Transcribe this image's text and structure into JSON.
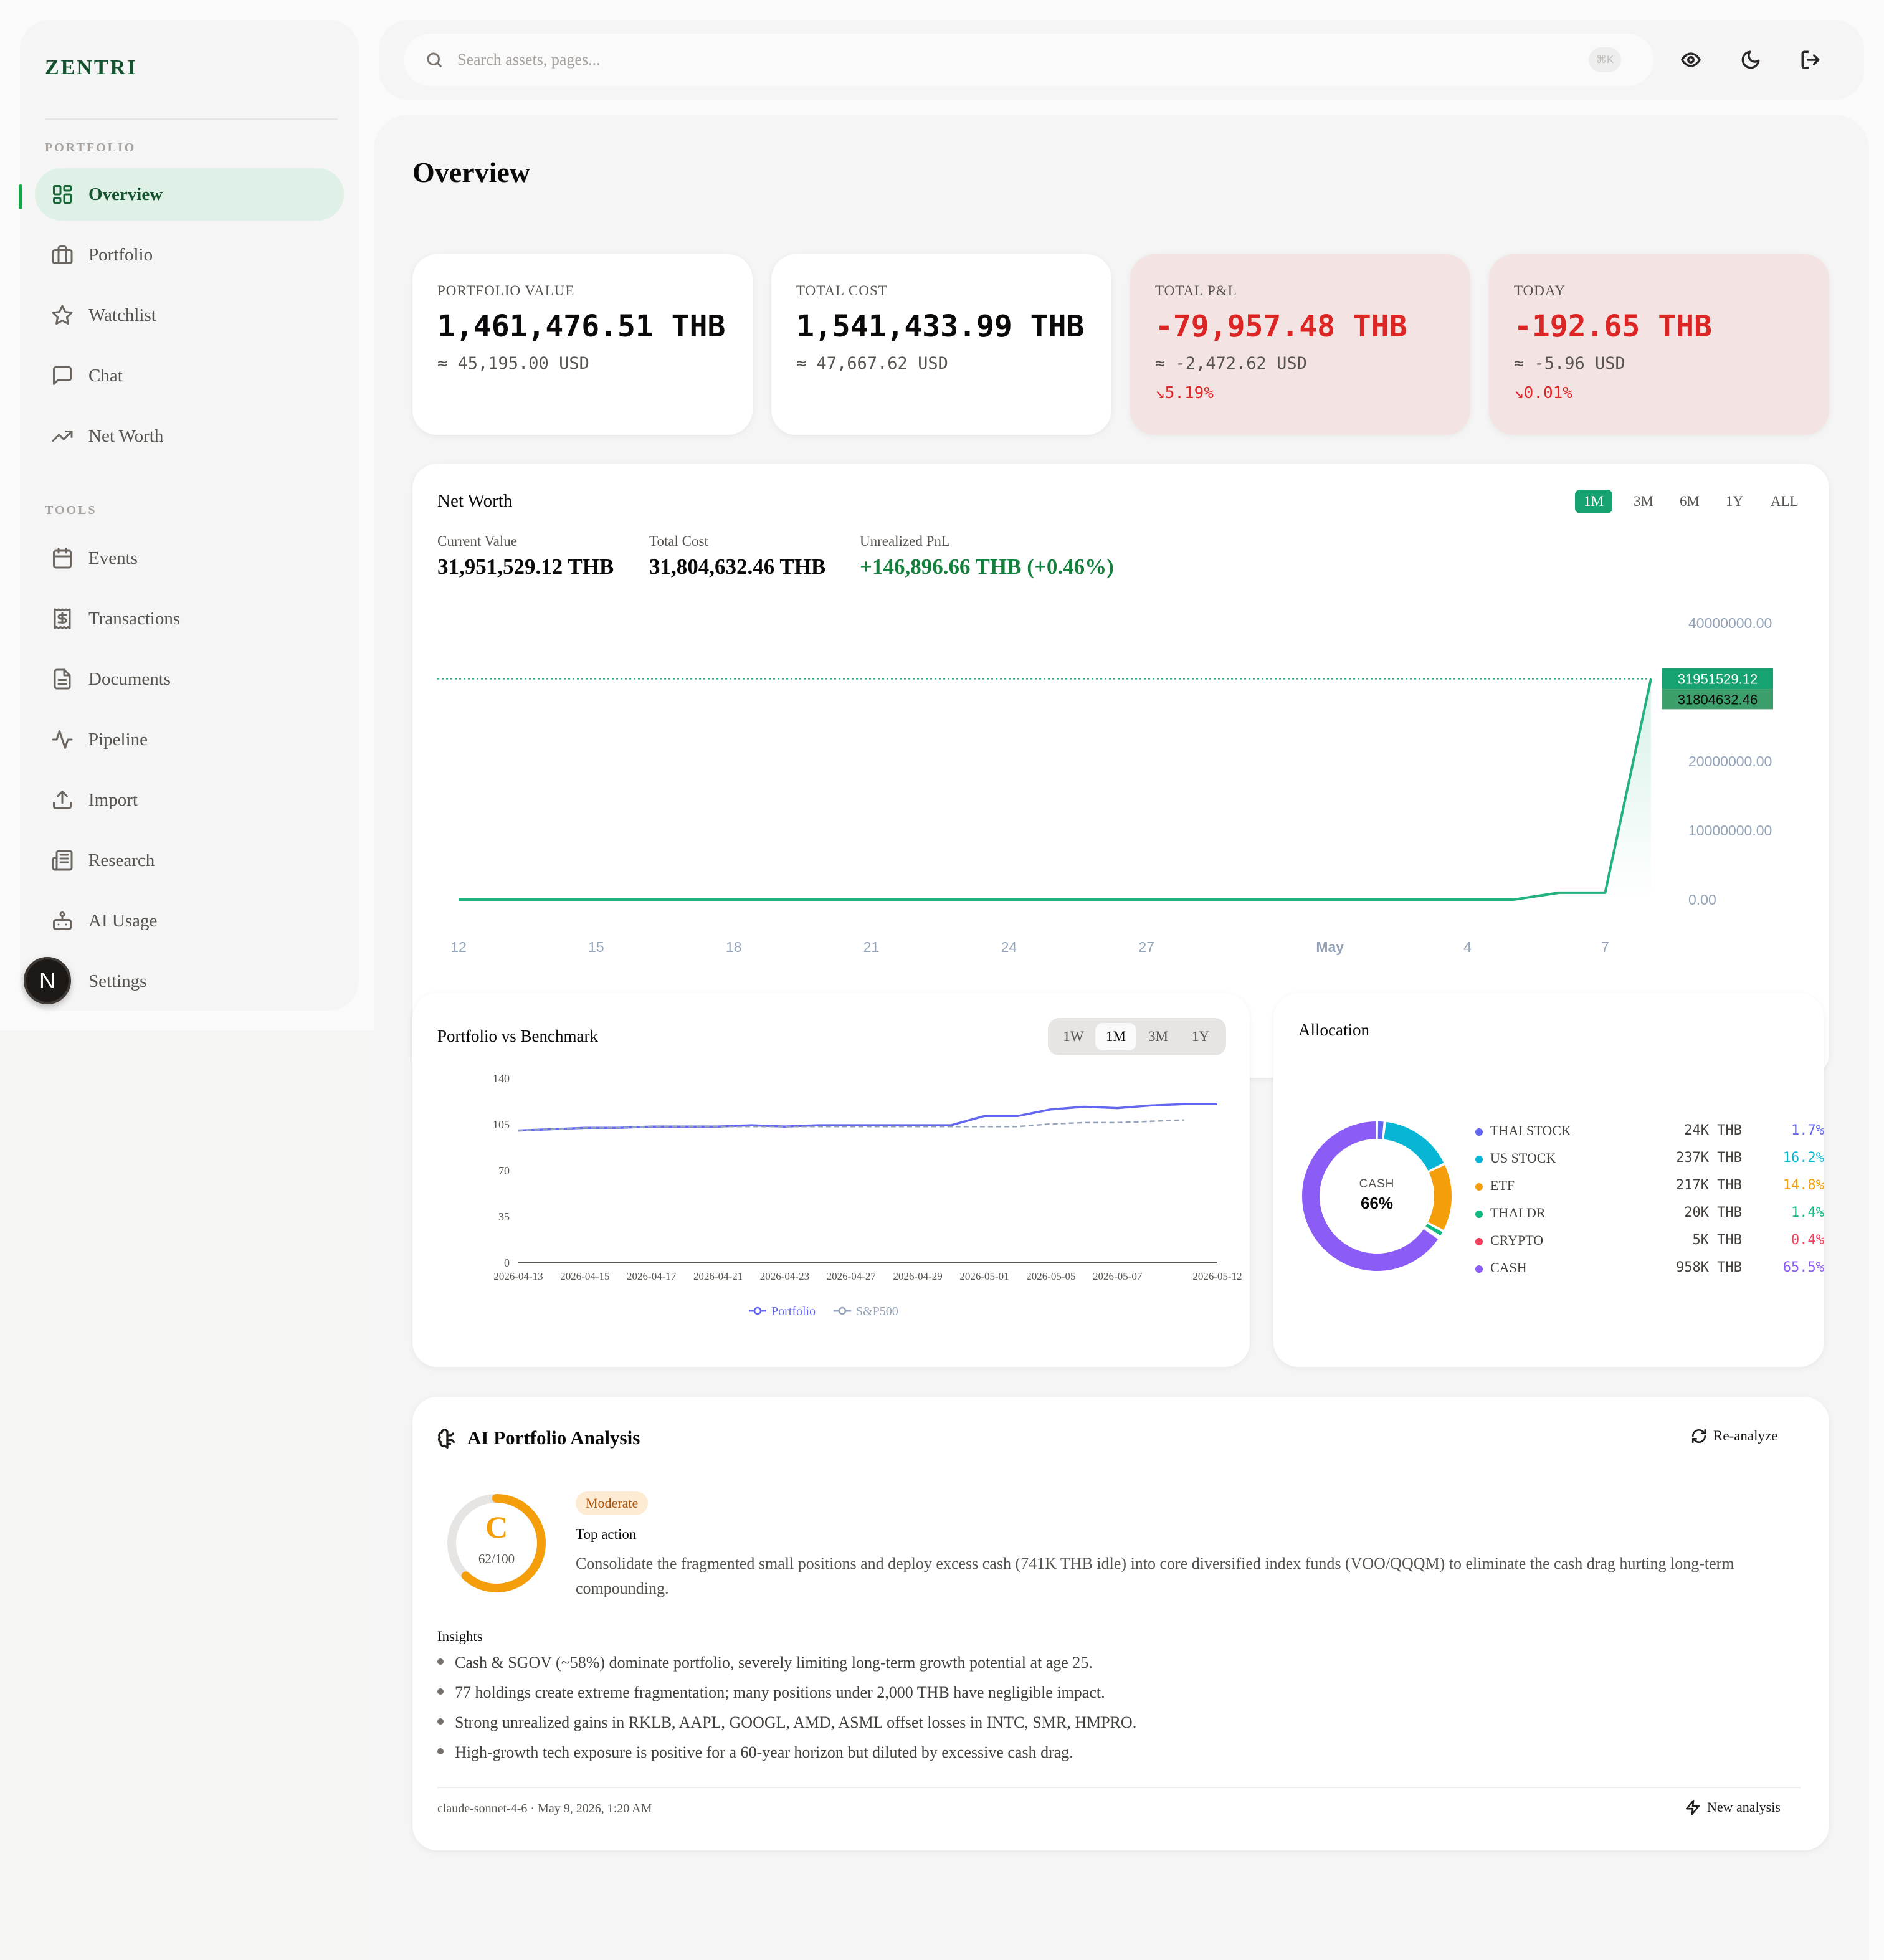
{
  "app": {
    "brand": "ZENTRI",
    "avatar_initial": "N"
  },
  "sidebar": {
    "portfolio_label": "PORTFOLIO",
    "tools_label": "TOOLS",
    "items": [
      {
        "label": "Overview",
        "icon": "grid-icon"
      },
      {
        "label": "Portfolio",
        "icon": "briefcase-icon"
      },
      {
        "label": "Watchlist",
        "icon": "star-icon"
      },
      {
        "label": "Chat",
        "icon": "chat-icon"
      },
      {
        "label": "Net Worth",
        "icon": "trend-icon"
      },
      {
        "label": "Events",
        "icon": "calendar-icon"
      },
      {
        "label": "Transactions",
        "icon": "receipt-icon"
      },
      {
        "label": "Documents",
        "icon": "document-icon"
      },
      {
        "label": "Pipeline",
        "icon": "activity-icon"
      },
      {
        "label": "Import",
        "icon": "upload-icon"
      },
      {
        "label": "Research",
        "icon": "newspaper-icon"
      },
      {
        "label": "AI Usage",
        "icon": "bot-icon"
      },
      {
        "label": "Settings",
        "icon": "gear-icon"
      }
    ]
  },
  "topbar": {
    "search_placeholder": "Search assets, pages...",
    "shortcut": "⌘K"
  },
  "page": {
    "title": "Overview"
  },
  "stats": [
    {
      "label": "PORTFOLIO VALUE",
      "value": "1,461,476.51 THB",
      "sub": "≈ 45,195.00 USD",
      "pct": ""
    },
    {
      "label": "TOTAL COST",
      "value": "1,541,433.99 THB",
      "sub": "≈ 47,667.62 USD",
      "pct": ""
    },
    {
      "label": "TOTAL P&L",
      "value": "-79,957.48 THB",
      "sub": "≈ -2,472.62 USD",
      "pct": "↘5.19%"
    },
    {
      "label": "TODAY",
      "value": "-192.65 THB",
      "sub": "≈ -5.96 USD",
      "pct": "↘0.01%"
    }
  ],
  "net_worth": {
    "title": "Net Worth",
    "ranges": [
      "1M",
      "3M",
      "6M",
      "1Y",
      "ALL"
    ],
    "active_range": "1M",
    "current_value_label": "Current Value",
    "current_value": "31,951,529.12 THB",
    "total_cost_label": "Total Cost",
    "total_cost": "31,804,632.46 THB",
    "pnl_label": "Unrealized PnL",
    "pnl": "+146,896.66 THB (+0.46%)",
    "marker_value": "31951529.12",
    "marker_cost": "31804632.46",
    "colors": {
      "line": "#22b07d",
      "marker_value": "#16a370",
      "marker_cost": "#3c9e6a"
    }
  },
  "benchmark": {
    "title": "Portfolio vs Benchmark",
    "ranges": [
      "1W",
      "1M",
      "3M",
      "1Y"
    ],
    "active_range": "1M",
    "colors": {
      "portfolio": "#6366f1",
      "sp500": "#94a3b8"
    }
  },
  "allocation": {
    "title": "Allocation",
    "center_label": "CASH",
    "center_value": "66%",
    "items": [
      {
        "name": "THAI STOCK",
        "amount": "24K THB",
        "pct": "1.7%",
        "color": "#6366f1",
        "value": 1.7
      },
      {
        "name": "US STOCK",
        "amount": "237K THB",
        "pct": "16.2%",
        "color": "#06b6d4",
        "value": 16.2
      },
      {
        "name": "ETF",
        "amount": "217K THB",
        "pct": "14.8%",
        "color": "#f59e0b",
        "value": 14.8
      },
      {
        "name": "THAI DR",
        "amount": "20K THB",
        "pct": "1.4%",
        "color": "#10b981",
        "value": 1.4
      },
      {
        "name": "CRYPTO",
        "amount": "5K THB",
        "pct": "0.4%",
        "color": "#f43f5e",
        "value": 0.4
      },
      {
        "name": "CASH",
        "amount": "958K THB",
        "pct": "65.5%",
        "color": "#8b5cf6",
        "value": 65.5
      }
    ]
  },
  "ai": {
    "title": "AI Portfolio Analysis",
    "reanalyze_label": "Re-analyze",
    "grade": "C",
    "score_text": "62/100",
    "score": 62,
    "risk_badge": "Moderate",
    "top_action_label": "Top action",
    "top_action": "Consolidate the fragmented small positions and deploy excess cash (741K THB idle) into core diversified index funds (VOO/QQQM) to eliminate the cash drag hurting long-term compounding.",
    "insights_label": "Insights",
    "insights": [
      "Cash & SGOV (~58%) dominate portfolio, severely limiting long-term growth potential at age 25.",
      "77 holdings create extreme fragmentation; many positions under 2,000 THB have negligible impact.",
      "Strong unrealized gains in RKLB, AAPL, GOOGL, AMD, ASML offset losses in INTC, SMR, HMPRO.",
      "High-growth tech exposure is positive for a 60-year horizon but diluted by excessive cash drag."
    ],
    "footer": "claude-sonnet-4-6 · May 9, 2026, 1:20 AM",
    "new_analysis_label": "New analysis",
    "colors": {
      "grade": "#f59e0b",
      "ring_track": "#e7e5e4"
    }
  },
  "chart_data": [
    {
      "type": "area",
      "name": "net-worth",
      "x": [
        "2026-04-12",
        "2026-04-13",
        "2026-04-14",
        "2026-04-15",
        "2026-04-16",
        "2026-04-17",
        "2026-04-18",
        "2026-04-19",
        "2026-04-20",
        "2026-04-21",
        "2026-04-22",
        "2026-04-23",
        "2026-04-24",
        "2026-04-25",
        "2026-04-26",
        "2026-04-27",
        "2026-04-28",
        "2026-04-29",
        "2026-04-30",
        "2026-05-01",
        "2026-05-02",
        "2026-05-03",
        "2026-05-04",
        "2026-05-05",
        "2026-05-06",
        "2026-05-07",
        "2026-05-08"
      ],
      "series": [
        {
          "values": [
            0,
            0,
            0,
            0,
            0,
            0,
            0,
            0,
            0,
            0,
            0,
            0,
            0,
            0,
            0,
            0,
            0,
            0,
            0,
            0,
            0,
            0,
            0,
            0,
            1000000,
            1000000,
            31951529.12
          ]
        }
      ],
      "x_tick_labels": [
        "12",
        "15",
        "18",
        "21",
        "24",
        "27",
        "May",
        "4",
        "7"
      ],
      "y_tick_labels": [
        "40000000.00",
        "30000000.00",
        "20000000.00",
        "10000000.00",
        "0.00"
      ],
      "ylim": [
        0,
        40000000
      ],
      "reference_line": 31951529.12
    },
    {
      "type": "line",
      "name": "portfolio-vs-benchmark",
      "x": [
        "2026-04-13",
        "2026-04-14",
        "2026-04-15",
        "2026-04-16",
        "2026-04-17",
        "2026-04-20",
        "2026-04-21",
        "2026-04-22",
        "2026-04-23",
        "2026-04-24",
        "2026-04-27",
        "2026-04-28",
        "2026-04-29",
        "2026-04-30",
        "2026-05-01",
        "2026-05-04",
        "2026-05-05",
        "2026-05-06",
        "2026-05-07",
        "2026-05-08",
        "2026-05-11",
        "2026-05-12"
      ],
      "series": [
        {
          "name": "Portfolio",
          "values": [
            100,
            101,
            102,
            102,
            103,
            103,
            103,
            104,
            103,
            104,
            104,
            104,
            104,
            104,
            111,
            111,
            116,
            118,
            117,
            119,
            120,
            120
          ]
        },
        {
          "name": "S&P500",
          "values": [
            100,
            101,
            102,
            102,
            103,
            103,
            103,
            103,
            103,
            103,
            103,
            103,
            103,
            103,
            103,
            103,
            105,
            106,
            106,
            107,
            108,
            null
          ]
        }
      ],
      "x_tick_labels": [
        "2026-04-13",
        "2026-04-15",
        "2026-04-17",
        "2026-04-21",
        "2026-04-23",
        "2026-04-27",
        "2026-04-29",
        "2026-05-01",
        "2026-05-05",
        "2026-05-07",
        "2026-05-12"
      ],
      "y_tick_labels": [
        "140",
        "105",
        "70",
        "35",
        "0"
      ],
      "ylim": [
        0,
        140
      ]
    }
  ]
}
